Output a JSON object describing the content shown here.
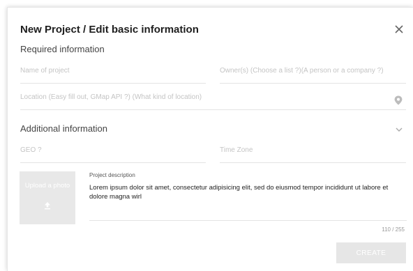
{
  "dialog": {
    "title": "New Project / Edit basic information"
  },
  "required": {
    "heading": "Required information",
    "project_name_placeholder": "Name of project",
    "owners_placeholder": "Owner(s) (Choose a list ?)(A person or a company ?)",
    "location_placeholder": "Location (Easy fill out, GMap API ?) (What kind of location)"
  },
  "additional": {
    "heading": "Additional information",
    "geo_placeholder": "GEO ?",
    "timezone_placeholder": "Time Zone",
    "upload_label": "Upload a photo",
    "description_caption": "Project description",
    "description_text": "Lorem ipsum dolor sit amet, consectetur adipisicing elit, sed do eiusmod tempor incididunt ut labore et dolore magna wirl",
    "char_counter": "110 / 255"
  },
  "actions": {
    "create_label": "CREATE"
  },
  "icons": {
    "close": "close-icon",
    "location": "location-pin-icon",
    "expand": "chevron-down-icon",
    "upload": "upload-icon"
  },
  "colors": {
    "placeholder": "#c4c4c4",
    "divider": "#e3e3e3",
    "button_bg": "#e6e6e6",
    "upload_bg": "#e8e8e8"
  }
}
